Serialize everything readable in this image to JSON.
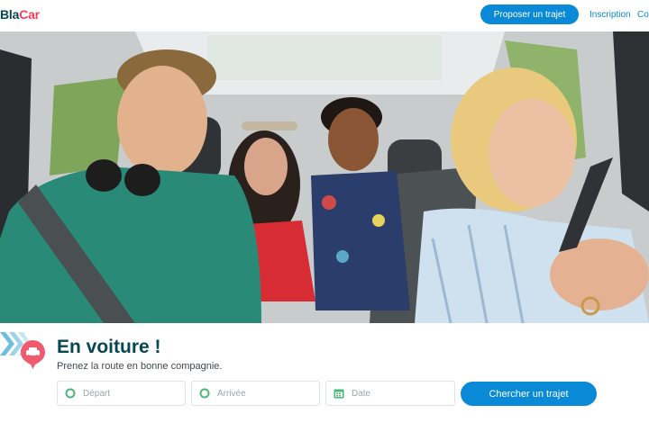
{
  "header": {
    "logo_part1": "Bla",
    "logo_part2": "Car",
    "offer_button": "Proposer un trajet",
    "signup_link": "Inscription",
    "login_link": "Co"
  },
  "hero": {
    "image": "people-in-car-photo"
  },
  "search": {
    "title": "En voiture !",
    "subtitle": "Prenez la route en bonne compagnie.",
    "departure_placeholder": "Départ",
    "arrival_placeholder": "Arrivée",
    "date_placeholder": "Date",
    "search_button": "Chercher un trajet"
  },
  "icons": {
    "departure": "circle-icon",
    "arrival": "circle-icon",
    "date": "calendar-icon",
    "badge": "car-pin-icon"
  },
  "colors": {
    "accent": "#0a8ad6",
    "brand_dark": "#054752",
    "brand_red": "#f53f5b",
    "field_icon": "#4cb87a"
  }
}
